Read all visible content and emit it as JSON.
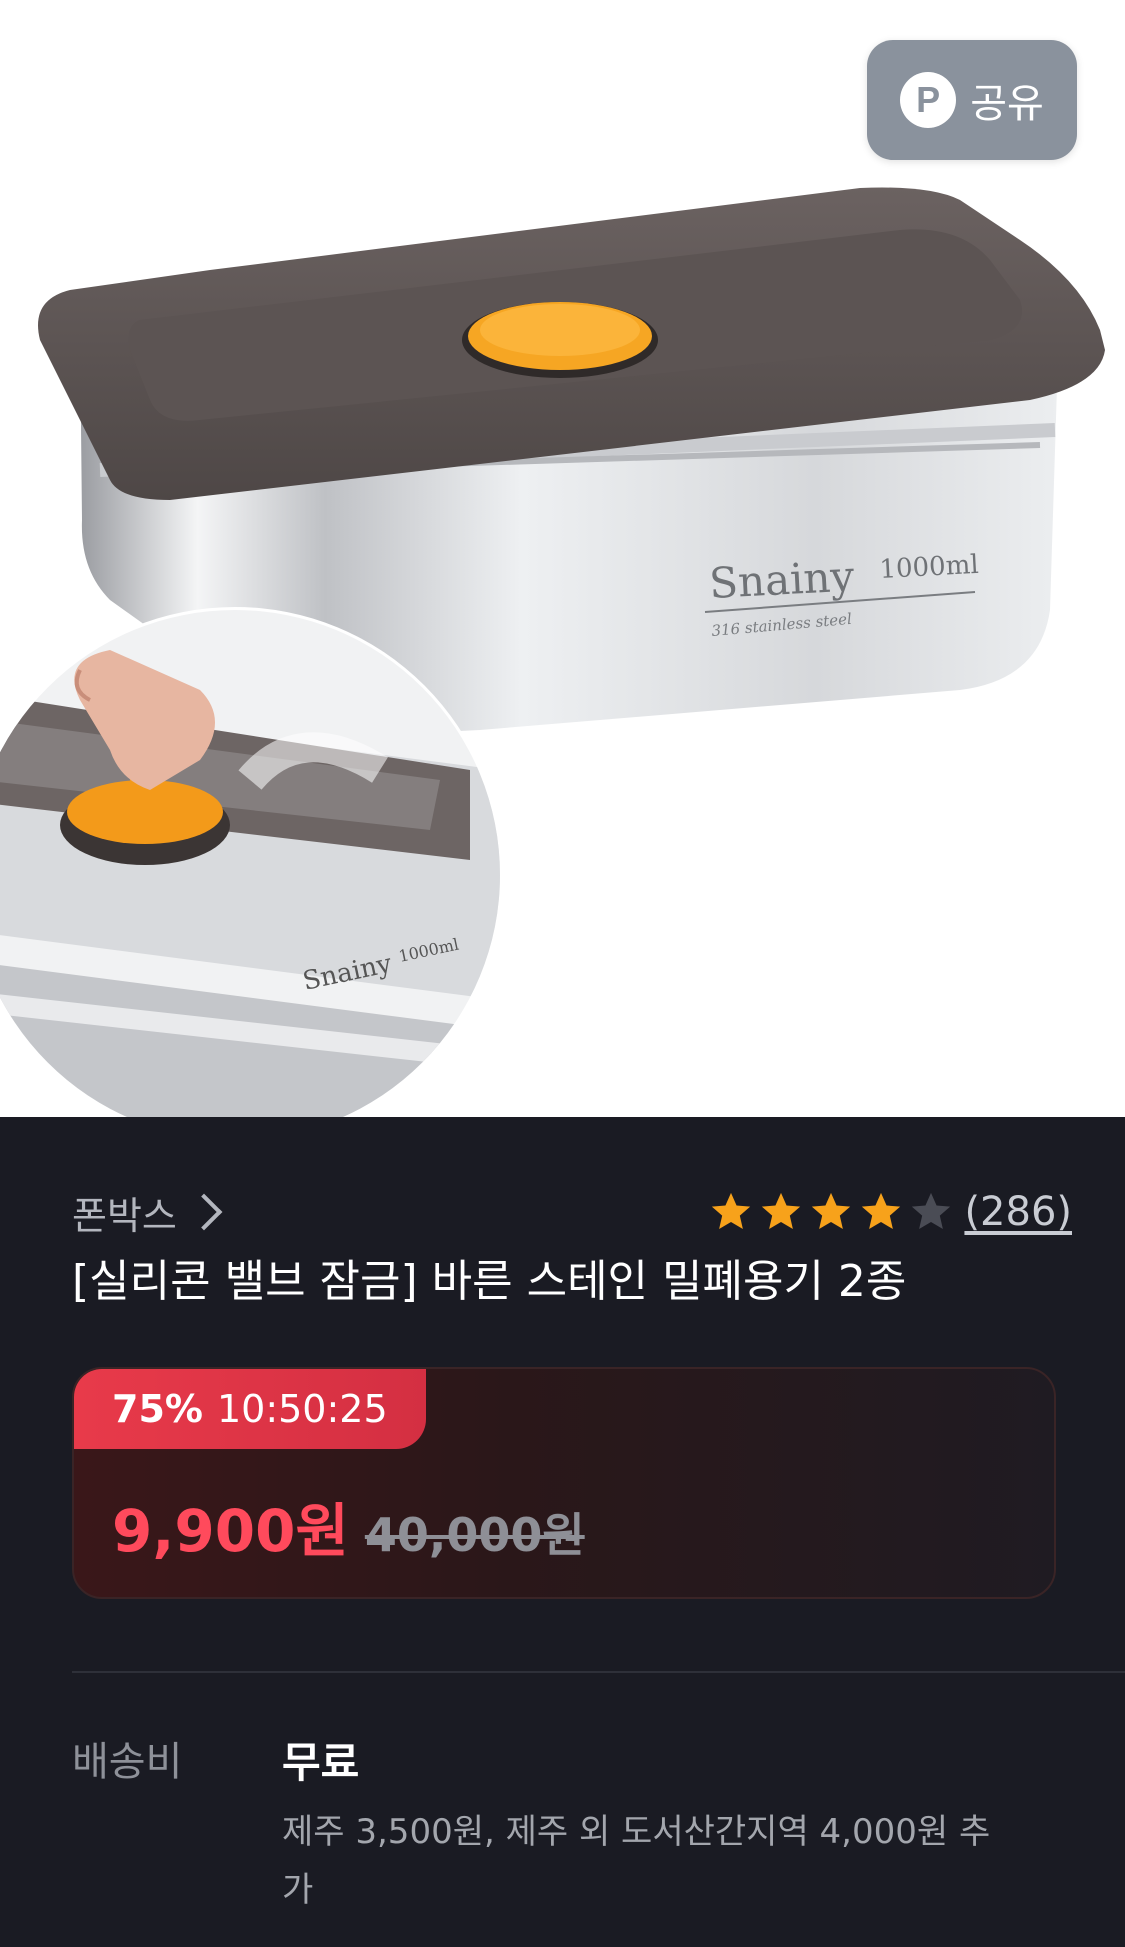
{
  "share": {
    "icon_letter": "P",
    "label": "공유"
  },
  "product": {
    "brand": "폰박스",
    "rating": 4,
    "rating_max": 5,
    "review_count": "(286)",
    "title": "[실리콘 밸브 잠금] 바른 스테인 밀폐용기 2종"
  },
  "image": {
    "brand_text": "Snainy",
    "capacity_text": "1000ml",
    "subtext": "316 stainless steel"
  },
  "deal": {
    "discount": "75%",
    "timer": "10:50:25",
    "sale_price": "9,900원",
    "original_price": "40,000원"
  },
  "shipping": {
    "label": "배송비",
    "value": "무료",
    "note": "제주 3,500원, 제주 외 도서산간지역 4,000원 추가"
  },
  "colors": {
    "accent": "#e83a4a",
    "sale_price": "#ff4a5c",
    "star": "#f7a21b",
    "background": "#1a1b23"
  }
}
